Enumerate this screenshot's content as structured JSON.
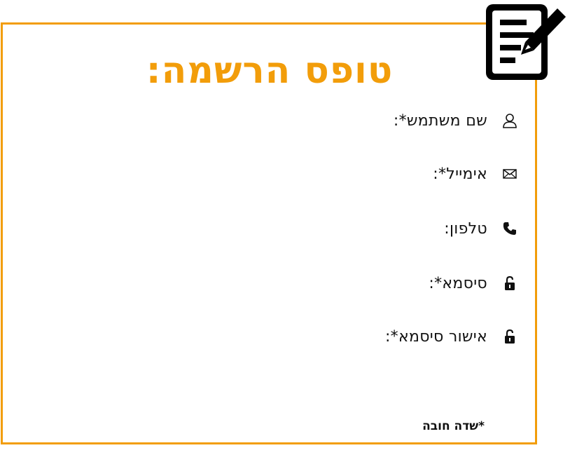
{
  "form": {
    "title": "טופס הרשמה:",
    "accent_color": "#f29d0a",
    "badge_icon": "form-edit-icon",
    "fields": [
      {
        "label": "שם משתמש*:",
        "icon": "user-icon"
      },
      {
        "label": "אימייל*:",
        "icon": "envelope-icon"
      },
      {
        "label": "טלפון:",
        "icon": "phone-icon"
      },
      {
        "label": "סיסמא*:",
        "icon": "lock-icon"
      },
      {
        "label": "אישור סיסמא*:",
        "icon": "lock-icon"
      }
    ],
    "required_note": "*שדה חובה"
  }
}
